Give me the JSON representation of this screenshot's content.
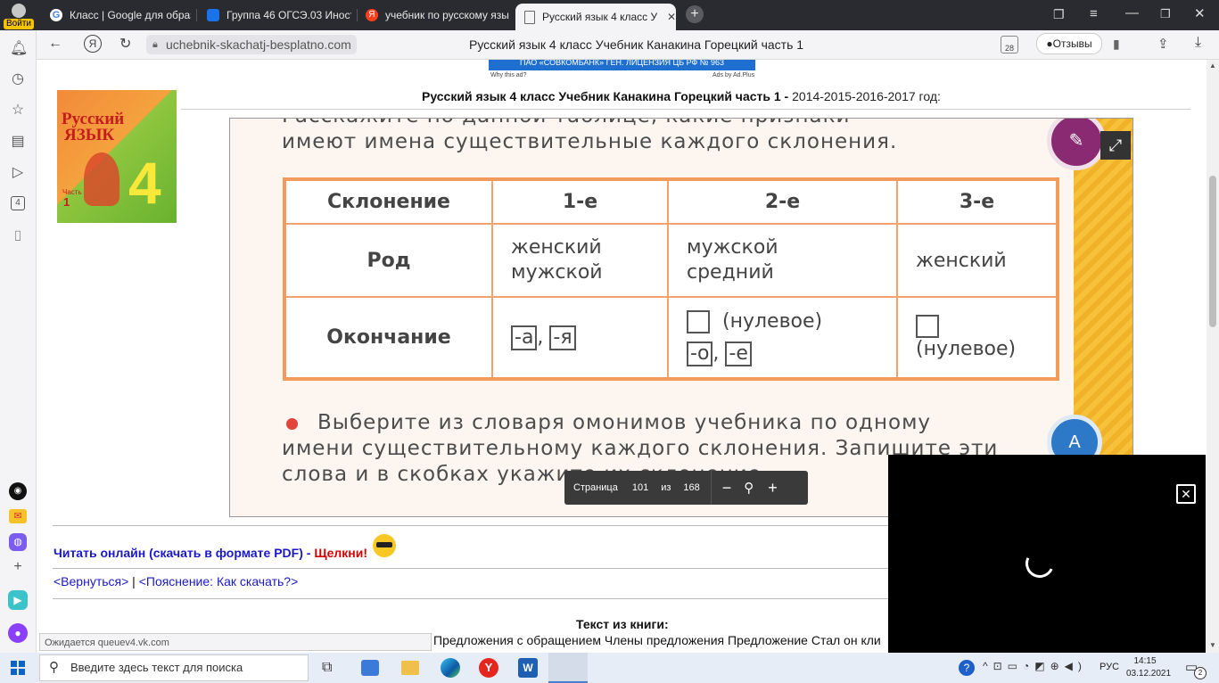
{
  "tabs": [
    {
      "label": "Войти",
      "icon": "profile-icon"
    },
    {
      "label": "Класс | Google для образо",
      "icon": "google-icon"
    },
    {
      "label": "Группа 46 ОГСЭ.03 Иност",
      "icon": "classroom-icon"
    },
    {
      "label": "учебник по русскому язы",
      "icon": "yandex-icon"
    },
    {
      "label": "Русский язык 4 класс У",
      "icon": "document-icon"
    }
  ],
  "address": {
    "url": "uchebnik-skachatj-besplatno.com",
    "page_title": "Русский язык 4 класс Учебник Канакина Горецкий часть 1",
    "badge": "28",
    "reviews_label": "Отзывы"
  },
  "sidebar": {
    "badge": "4"
  },
  "ad": {
    "banner_text": "ПАО «СОВКОМБАНК» ГЕН. ЛИЦЕНЗИЯ ЦБ РФ № 963",
    "why": "Why this ad?",
    "by": "Ads by Ad.Plus"
  },
  "book_cover": {
    "title_line1": "Русский",
    "title_line2": "язык",
    "grade": "4",
    "part_label": "Часть",
    "part_num": "1"
  },
  "heading": {
    "bold": "Русский язык 4 класс Учебник Канакина Горецкий часть 1 -",
    "years": " 2014-2015-2016-2017 год:"
  },
  "page": {
    "top_line1": "Расскажите по данной таблице, какие признаки",
    "top_line2": "имеют имена существительные каждого склонения.",
    "table": {
      "headers": [
        "Склонение",
        "1-е",
        "2-е",
        "3-е"
      ],
      "row1": {
        "label": "Род",
        "c1_l1": "женский",
        "c1_l2": "мужской",
        "c2_l1": "мужской",
        "c2_l2": "средний",
        "c3": "женский"
      },
      "row2": {
        "label": "Окончание",
        "c1_a": "-а",
        "c1_sep": ",",
        "c1_b": "-я",
        "c2_null": "(нулевое)",
        "c2_a": "-о",
        "c2_sep": ",",
        "c2_b": "-е",
        "c3_null": "(нулевое)"
      }
    },
    "task_line1": "Выберите из словаря омонимов учебника по одному",
    "task_line2": "имени существительному каждого склонения. Запишите эти",
    "task_line3": "слова и в скобках укажите их склонение."
  },
  "pager": {
    "label": "Страница",
    "current": "101",
    "of": "из",
    "total": "168"
  },
  "read_link": {
    "text": "Читать онлайн (скачать в формате PDF) - ",
    "click": "Щелкни!"
  },
  "nav_links": {
    "back": "<Вернуться>",
    "sep": " | ",
    "help": "<Пояснение: Как скачать?>"
  },
  "book_text": {
    "title": "Текст из книги:",
    "line": "Предложения с обращением Члены предложения Предложение Стал он кли"
  },
  "status_text": "Ожидается queuev4.vk.com",
  "taskbar": {
    "search_placeholder": "Введите здесь текст для поиска",
    "lang": "РУС",
    "time": "14:15",
    "date": "03.12.2021",
    "notifications": "2"
  }
}
